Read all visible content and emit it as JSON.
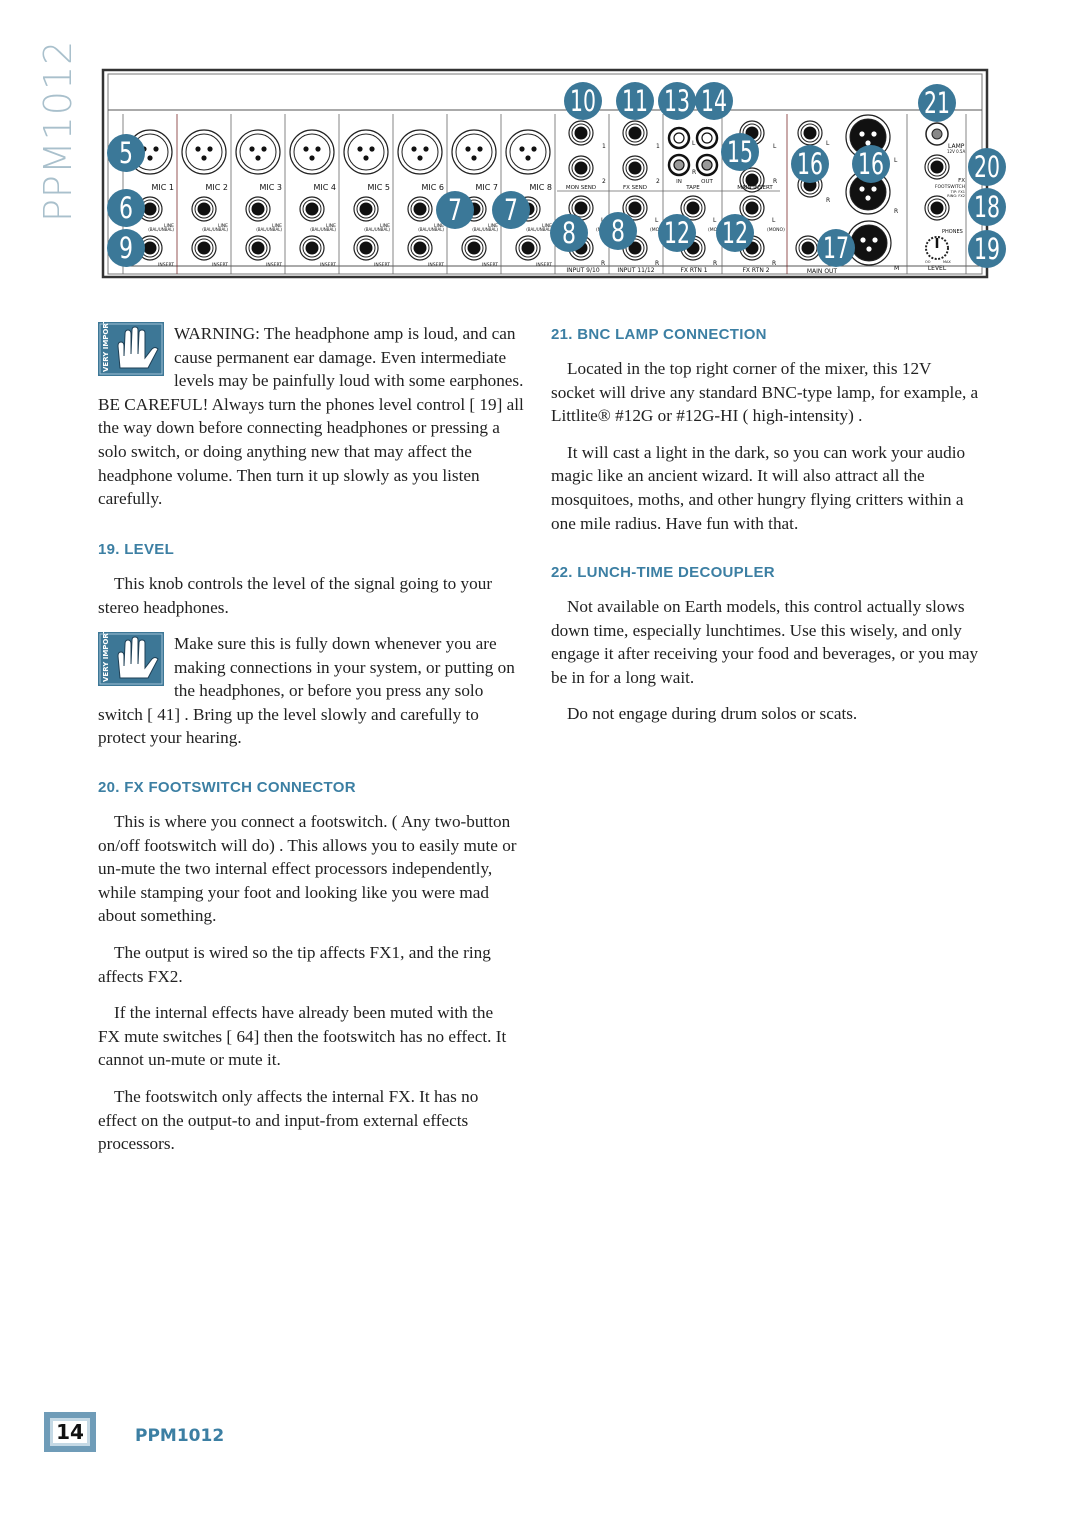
{
  "side_title": "PPM1012",
  "colors": {
    "accent": "#3c7fa3",
    "callout": "#3b7898",
    "side_title": "#a9c0cc"
  },
  "diagram": {
    "mic_labels": [
      "MIC 1",
      "MIC 2",
      "MIC 3",
      "MIC 4",
      "MIC 5",
      "MIC 6",
      "MIC 7",
      "MIC 8"
    ],
    "line_label": "LINE",
    "bal_label": "(BAL/UNBAL)",
    "insert_label": "INSERT",
    "hiz_label": "HI-Z",
    "mon_send": "MON SEND",
    "fx_send": "FX SEND",
    "tape": "TAPE",
    "tape_in": "IN",
    "tape_out": "OUT",
    "main_insert": "MAIN INSERT",
    "input_9_10": "INPUT 9/10",
    "input_11_12": "INPUT 11/12",
    "fx_rtn_1": "FX RTN 1",
    "fx_rtn_2": "FX RTN 2",
    "mono": "(MONO)",
    "main_out": "MAIN OUT",
    "lamp": "LAMP",
    "lamp_spec": "12V 0.5A",
    "fx_footswitch": "FX",
    "footswitch": "FOOTSWITCH",
    "footswitch_tip": "TIP: FX1",
    "footswitch_ring": "RING: FX2",
    "phones": "PHONES",
    "level": "LEVEL",
    "knob_min": "OO",
    "knob_max": "MAX",
    "L": "L",
    "R": "R",
    "M": "M",
    "one": "1",
    "two": "2",
    "callouts": [
      "5",
      "6",
      "9",
      "7",
      "7",
      "8",
      "8",
      "10",
      "11",
      "13",
      "14",
      "15",
      "16",
      "16",
      "12",
      "12",
      "17",
      "21",
      "20",
      "18",
      "19"
    ]
  },
  "icons": {
    "warning": "very-important-hand-icon",
    "warning_text": "VERY IMPORTANT"
  },
  "left": {
    "warning1": "WARNING: The headphone amp is loud, and can cause permanent ear damage. Even intermediate levels may be painfully loud with some earphones. BE CAREFUL! Always turn the phones level control [ 19]  all the way down before connecting headphones or pressing a solo switch, or doing anything new that may affect the headphone volume. Then turn it up slowly as you listen carefully.",
    "h19": "19.  LEVEL",
    "p19": "This knob controls the level of the signal going to your stereo headphones.",
    "warning2": "Make sure this is fully down whenever you are making connections in your system, or putting on the headphones, or before you press any solo switch [ 41] . Bring up the level slowly and carefully to protect your hearing.",
    "h20": "20.  FX FOOTSWITCH CONNECTOR",
    "p20": [
      "This is where you connect a footswitch. ( Any two-button on/off footswitch will do) . This allows you to easily mute or un-mute the two internal effect processors independently, while stamping your foot and looking like you were mad about something.",
      "The output is wired so the tip affects FX1, and the ring affects FX2.",
      "If the internal effects have already been muted with the FX mute switches [ 64]  then the footswitch has no effect. It cannot un-mute or mute it.",
      "The footswitch only affects the internal FX. It has no effect on the output-to and input-from external effects processors."
    ]
  },
  "right": {
    "h21": "21.  BNC LAMP CONNECTION",
    "p21": [
      "Located in the top right corner of the mixer, this 12V socket will drive any standard BNC-type lamp, for example, a Littlite® #12G or #12G-HI ( high-intensity) .",
      "It will cast a light in the dark, so you can work your audio magic like an ancient wizard. It will also attract all the mosquitoes, moths, and other hungry flying critters within a one mile radius. Have fun with that."
    ],
    "h22": "22.  LUNCH-TIME DECOUPLER",
    "p22": [
      "Not available on Earth models, this control actually slows down time, especially lunchtimes. Use this wisely, and only engage it after receiving your food and beverages, or you may be in for a long wait.",
      "Do not engage during drum solos or scats."
    ]
  },
  "footer": {
    "page_number": "14",
    "title": "PPM1012"
  }
}
